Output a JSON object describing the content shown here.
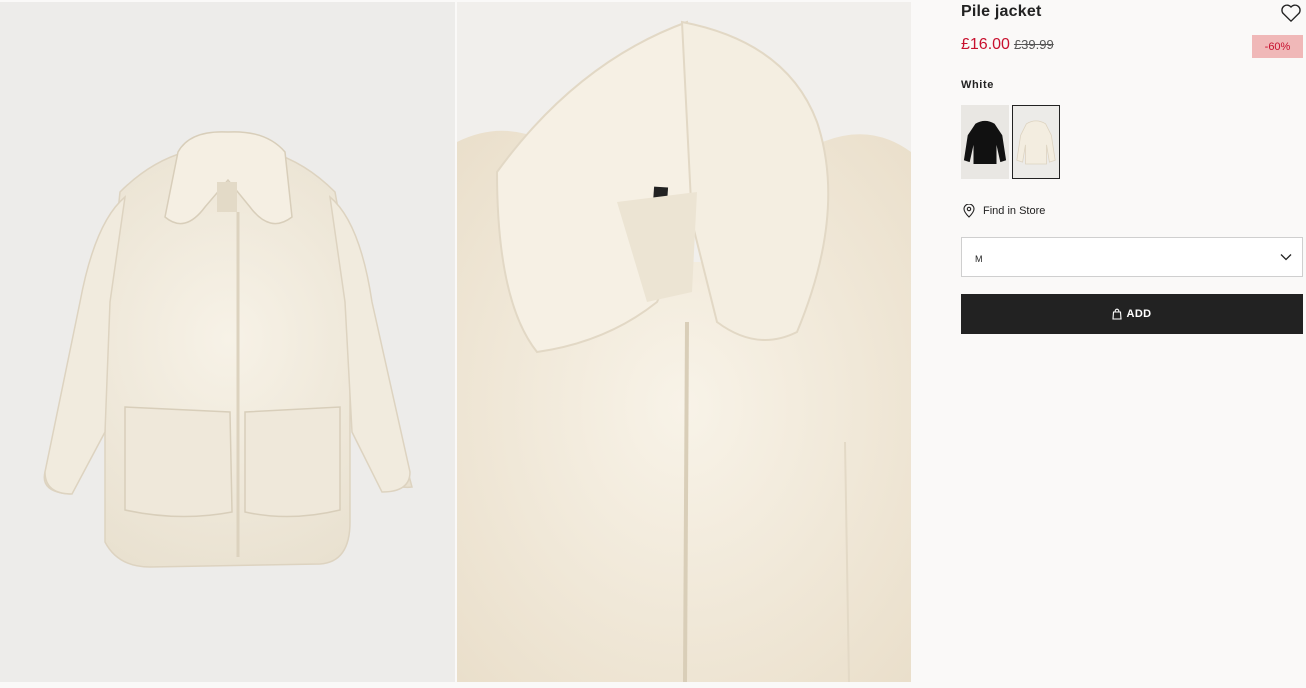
{
  "product": {
    "title": "Pile jacket",
    "price_now": "£16.00",
    "price_old": "£39.99",
    "discount": "-60%",
    "color_label": "White"
  },
  "swatches": [
    {
      "color": "black",
      "selected": false
    },
    {
      "color": "white",
      "selected": true
    }
  ],
  "find_in_store": "Find in Store",
  "size_select": {
    "value": "M"
  },
  "add_button": {
    "label": "ADD"
  },
  "colors": {
    "price_red": "#c8102e",
    "discount_bg": "#f0b8b8",
    "button_bg": "#222222",
    "coat_cream": "#f3ede0"
  },
  "icons": [
    "heart-icon",
    "location-pin-icon",
    "chevron-down-icon",
    "bag-icon"
  ]
}
